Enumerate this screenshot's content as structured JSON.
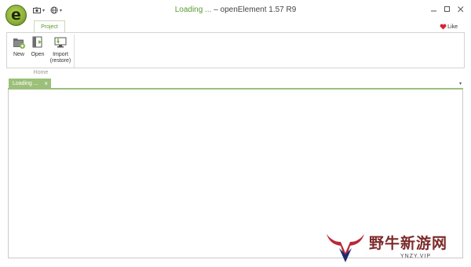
{
  "window": {
    "loading_text": "Loading ...",
    "title_text": "openElement 1.57 R9",
    "app_logo_letter": "e"
  },
  "quick_access": {
    "caret": "▾"
  },
  "ribbon": {
    "tabs": [
      {
        "label": "Project",
        "active": true
      }
    ],
    "like_label": "Like",
    "buttons": [
      {
        "label": "New"
      },
      {
        "label": "Open"
      },
      {
        "label": "Import\n(restore)"
      }
    ],
    "group_label": "Home"
  },
  "documents": {
    "tabs": [
      {
        "label": "Loading ...",
        "close": "×"
      }
    ],
    "menu_caret": "▾"
  },
  "watermark": {
    "text": "野牛新游网",
    "sub": "YNZY.VIP"
  },
  "colors": {
    "accent_green": "#5b9a32",
    "tab_green": "#9cc07a",
    "heart_red": "#d9232e"
  }
}
